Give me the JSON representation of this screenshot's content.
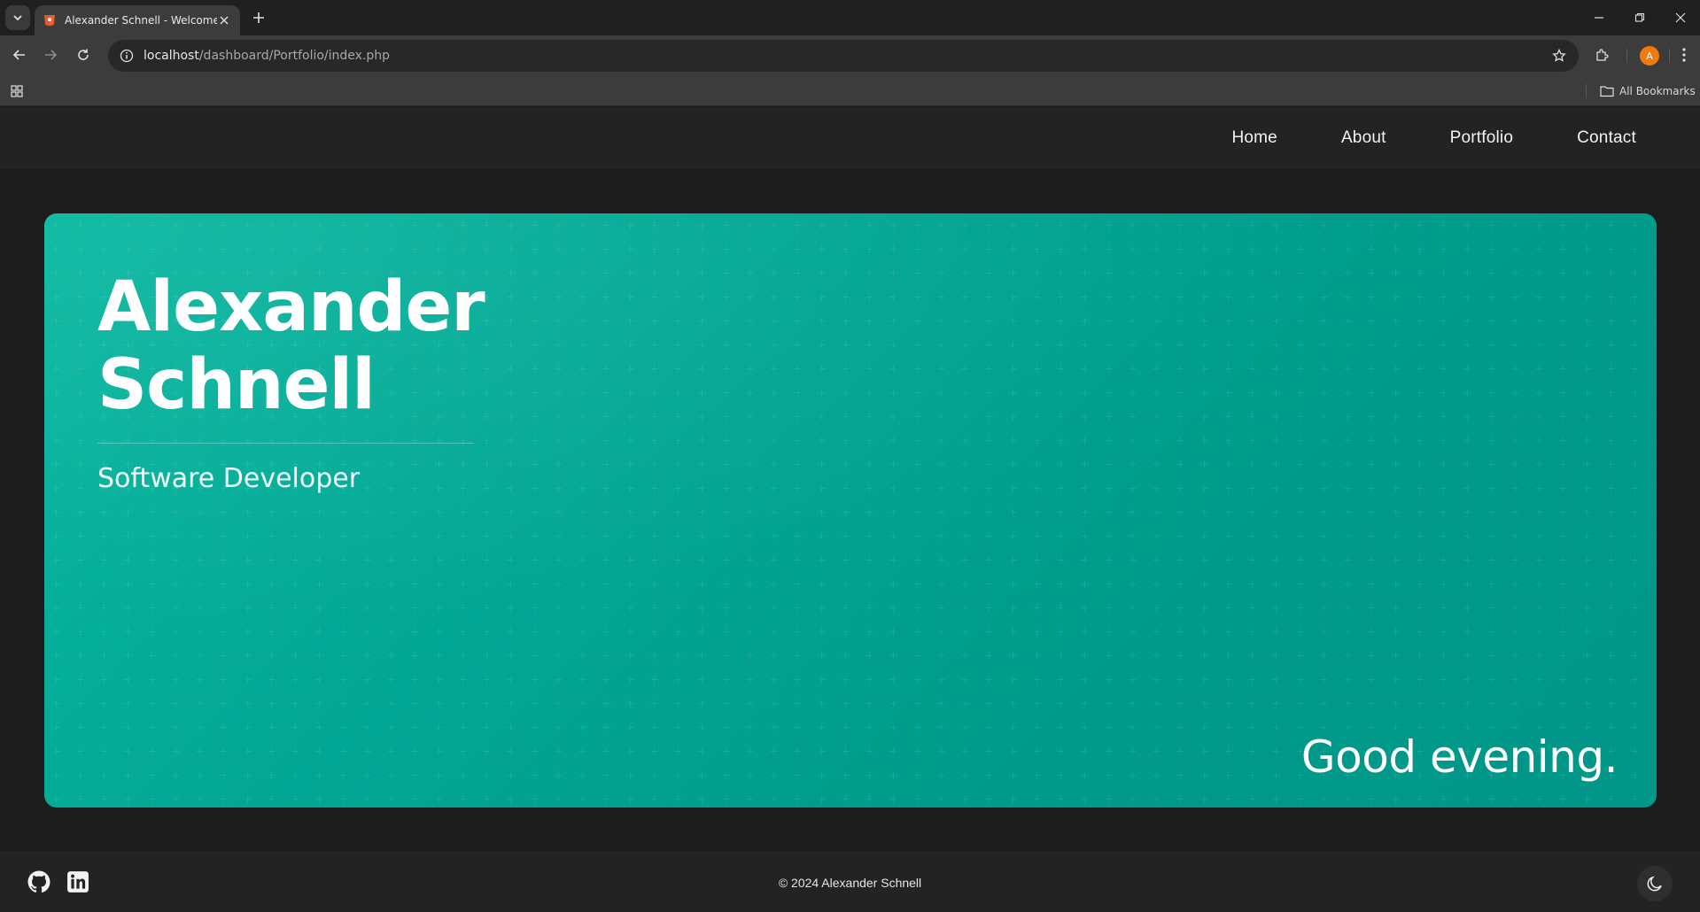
{
  "browser": {
    "tab": {
      "title": "Alexander Schnell - Welcome",
      "favicon": "html5-icon"
    },
    "address": {
      "host": "localhost",
      "path": "/dashboard/Portfolio/index.php"
    },
    "profile_initial": "A",
    "bookmarks": {
      "all_label": "All Bookmarks"
    }
  },
  "site": {
    "nav": [
      {
        "label": "Home"
      },
      {
        "label": "About"
      },
      {
        "label": "Portfolio"
      },
      {
        "label": "Contact"
      }
    ],
    "hero": {
      "name_line1": "Alexander",
      "name_line2": "Schnell",
      "role": "Software Developer",
      "greeting": "Good evening."
    },
    "footer": {
      "copyright": "© 2024 Alexander Schnell",
      "social": [
        "github-icon",
        "linkedin-icon"
      ],
      "theme_toggle_icon": "moon-icon"
    }
  },
  "colors": {
    "hero_gradient_start": "#08b8a0",
    "hero_gradient_end": "#009688",
    "page_background": "#1c1c1c",
    "nav_background": "#232323",
    "profile_badge": "#f07a0c"
  }
}
